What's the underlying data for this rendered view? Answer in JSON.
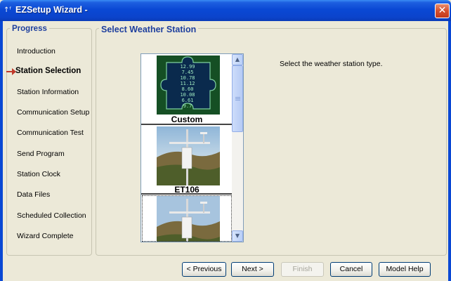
{
  "window": {
    "title": "EZSetup Wizard -",
    "close_glyph": "✕"
  },
  "progress": {
    "heading": "Progress",
    "steps": [
      {
        "label": "Introduction"
      },
      {
        "label": "Station Selection",
        "active": true
      },
      {
        "label": "Station Information"
      },
      {
        "label": "Communication Setup"
      },
      {
        "label": "Communication Test"
      },
      {
        "label": "Send Program"
      },
      {
        "label": "Station Clock"
      },
      {
        "label": "Data Files"
      },
      {
        "label": "Scheduled Collection"
      },
      {
        "label": "Wizard Complete"
      }
    ]
  },
  "main": {
    "heading": "Select Weather Station",
    "instruction": "Select the weather station type.",
    "stations": [
      {
        "label": "Custom",
        "icon": "puzzle-piece-icon",
        "puzzle_numbers": [
          "12.99",
          "7.45",
          "10.78",
          "11.12",
          "8.60",
          "10.08",
          "6.61",
          "9.7"
        ]
      },
      {
        "label": "ET106",
        "icon": "weather-station-photo"
      },
      {
        "label": "",
        "icon": "weather-station-photo"
      }
    ]
  },
  "buttons": {
    "previous": "< Previous",
    "next": "Next >",
    "finish": "Finish",
    "cancel": "Cancel",
    "model_help": "Model Help"
  },
  "colors": {
    "titlebar_blue": "#0a48d4",
    "heading_blue": "#1e3f9e",
    "active_arrow": "#c0392b"
  }
}
